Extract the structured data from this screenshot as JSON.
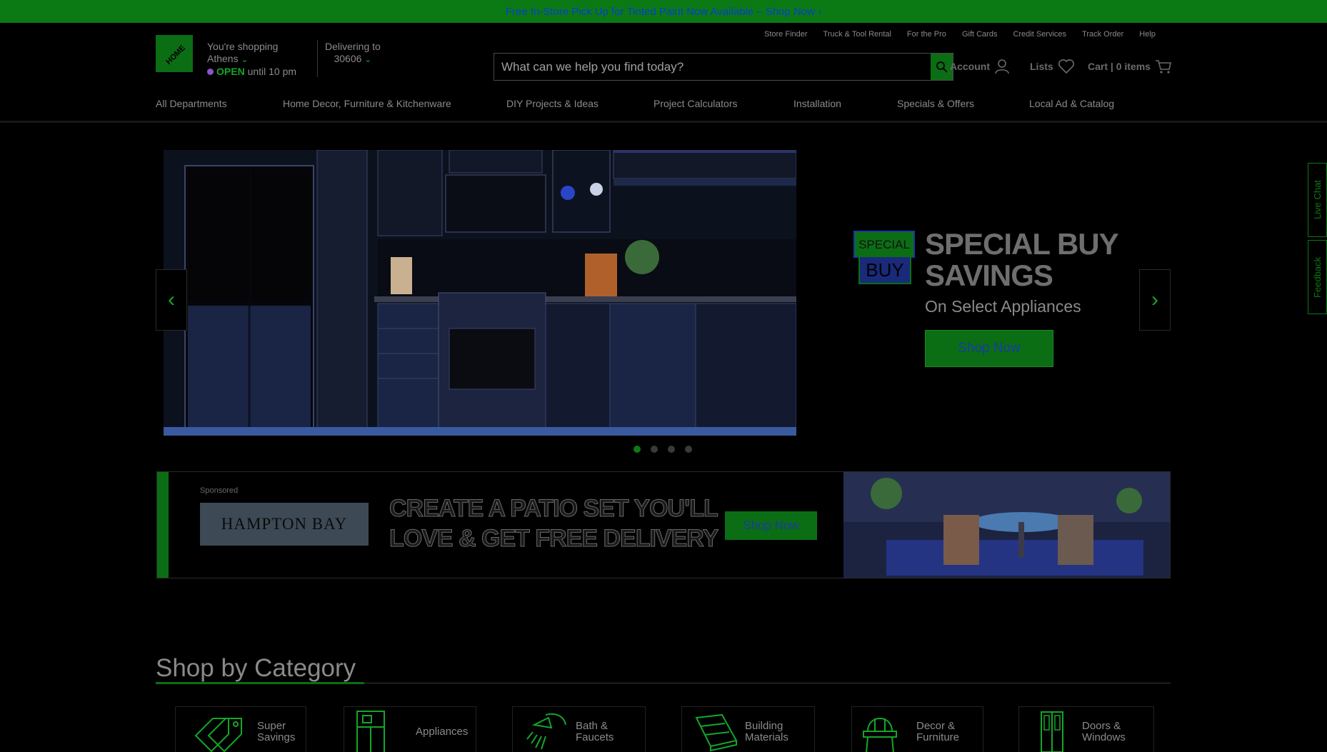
{
  "promo": {
    "text": "Free In-Store Pick Up for Tinted Paint Now Available – Shop Now"
  },
  "header": {
    "shopping_label": "You're shopping",
    "store_name": "Athens",
    "open_status": "OPEN",
    "open_hours": "until 10 pm",
    "delivering_label": "Delivering to",
    "zip": "30606",
    "util_links": [
      "Store Finder",
      "Truck & Tool Rental",
      "For the Pro",
      "Gift Cards",
      "Credit Services",
      "Track Order",
      "Help"
    ],
    "search_placeholder": "What can we help you find today?",
    "account_label": "Account",
    "lists_label": "Lists",
    "cart_label": "Cart | 0 items"
  },
  "nav": {
    "items": [
      "All Departments",
      "Home Decor, Furniture & Kitchenware",
      "DIY Projects & Ideas",
      "Project Calculators",
      "Installation",
      "Specials & Offers",
      "Local Ad & Catalog"
    ]
  },
  "hero": {
    "badge_top": "SPECIAL",
    "badge_bottom": "BUY",
    "title_line1": "SPECIAL BUY",
    "title_line2": "SAVINGS",
    "subtitle": "On Select Appliances",
    "cta": "Shop Now",
    "slide_count": 4,
    "active_slide": 1
  },
  "sponsored": {
    "label": "Sponsored",
    "brand": "HAMPTON BAY",
    "headline_line1": "CREATE A PATIO SET YOU'LL",
    "headline_line2": "LOVE & GET FREE DELIVERY",
    "cta": "Shop Now"
  },
  "categories": {
    "title": "Shop by Category",
    "items": [
      {
        "label_line1": "Super",
        "label_line2": "Savings",
        "icon": "tags-icon"
      },
      {
        "label_line1": "Appliances",
        "label_line2": "",
        "icon": "refrigerator-icon"
      },
      {
        "label_line1": "Bath &",
        "label_line2": "Faucets",
        "icon": "shower-icon"
      },
      {
        "label_line1": "Building",
        "label_line2": "Materials",
        "icon": "lumber-icon"
      },
      {
        "label_line1": "Decor &",
        "label_line2": "Furniture",
        "icon": "chair-icon"
      },
      {
        "label_line1": "Doors &",
        "label_line2": "Windows",
        "icon": "door-icon"
      }
    ]
  },
  "side": {
    "live_chat": "Live Chat",
    "feedback": "Feedback"
  },
  "colors": {
    "brand_green": "#0b6e14",
    "accent_green": "#14a62a",
    "link_blue": "#0a3bd6"
  }
}
